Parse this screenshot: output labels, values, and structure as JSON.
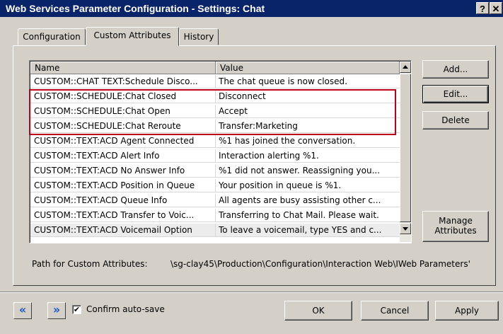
{
  "window": {
    "title": "Web Services Parameter Configuration - Settings: Chat",
    "help_label": "?",
    "close_label": "✕"
  },
  "tabs": [
    {
      "label": "Configuration",
      "active": false
    },
    {
      "label": "Custom Attributes",
      "active": true
    },
    {
      "label": "History",
      "active": false
    }
  ],
  "list": {
    "columns": [
      "Name",
      "Value"
    ],
    "rows": [
      {
        "name": "CUSTOM::CHAT TEXT:Schedule Disco...",
        "value": "The chat queue is now closed."
      },
      {
        "name": "CUSTOM::SCHEDULE:Chat Closed",
        "value": "Disconnect"
      },
      {
        "name": "CUSTOM::SCHEDULE:Chat Open",
        "value": "Accept"
      },
      {
        "name": "CUSTOM::SCHEDULE:Chat Reroute",
        "value": "Transfer:Marketing"
      },
      {
        "name": "CUSTOM::TEXT:ACD Agent Connected",
        "value": "%1 has joined the conversation."
      },
      {
        "name": "CUSTOM::TEXT:ACD Alert Info",
        "value": "Interaction alerting %1."
      },
      {
        "name": "CUSTOM::TEXT:ACD No Answer Info",
        "value": "%1 did not answer. Reassigning you..."
      },
      {
        "name": "CUSTOM::TEXT:ACD Position in Queue",
        "value": "Your position in queue is %1."
      },
      {
        "name": "CUSTOM::TEXT:ACD Queue Info",
        "value": "All agents are busy assisting other c..."
      },
      {
        "name": "CUSTOM::TEXT:ACD Transfer to Voic...",
        "value": "Transferring to Chat Mail.  Please wait."
      },
      {
        "name": "CUSTOM::TEXT:ACD Voicemail Option",
        "value": "To leave a voicemail, type YES and c..."
      }
    ],
    "highlight_color": "#c0001a"
  },
  "side_buttons": {
    "add": "Add...",
    "edit": "Edit...",
    "delete": "Delete",
    "manage_line1": "Manage",
    "manage_line2": "Attributes"
  },
  "path": {
    "label": "Path for Custom Attributes:",
    "value": "\\sg-clay45\\Production\\Configuration\\Interaction Web\\IWeb Parameters'"
  },
  "footer": {
    "back_icon": "«",
    "forward_icon": "»",
    "confirm_label": "Confirm auto-save",
    "confirm_checked": "✔",
    "ok": "OK",
    "cancel": "Cancel",
    "apply": "Apply"
  }
}
